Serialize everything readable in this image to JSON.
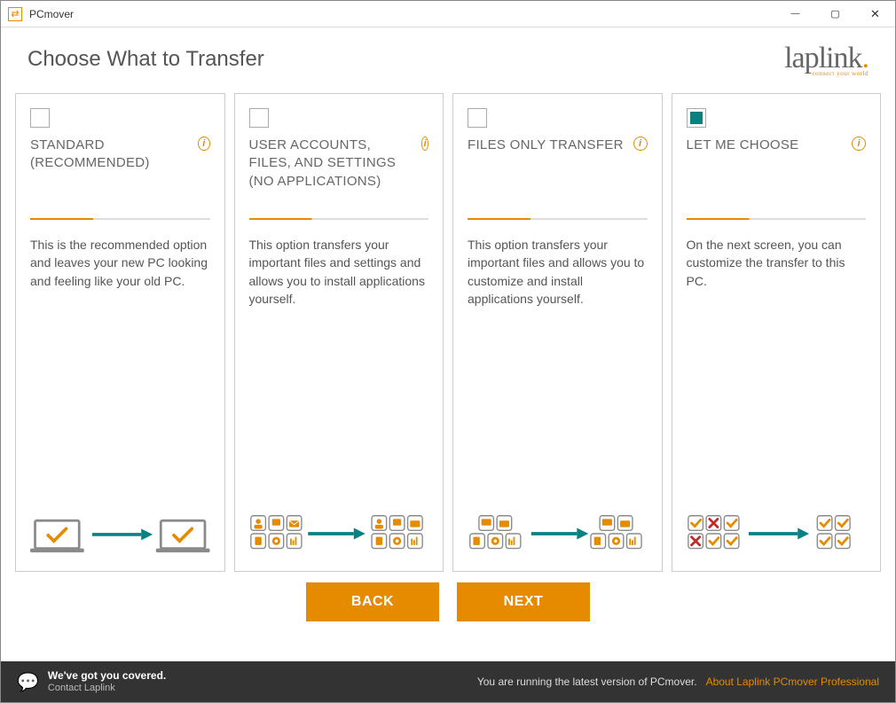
{
  "window": {
    "title": "PCmover"
  },
  "header": {
    "page_title": "Choose What to Transfer",
    "brand": "laplink",
    "brand_sub": "connect your world"
  },
  "cards": [
    {
      "title": "STANDARD (RECOMMENDED)",
      "desc": "This is the recommended option and leaves your new PC looking and feeling like your old PC.",
      "selected": false
    },
    {
      "title": "USER ACCOUNTS, FILES, AND SETTINGS (NO APPLICATIONS)",
      "desc": "This option transfers your important files and settings and allows you to install applications yourself.",
      "selected": false
    },
    {
      "title": "FILES ONLY TRANSFER",
      "desc": "This option transfers your important files and allows you to customize and install applications yourself.",
      "selected": false
    },
    {
      "title": "LET ME CHOOSE",
      "desc": "On the next screen, you can customize the transfer to this PC.",
      "selected": true
    }
  ],
  "nav": {
    "back": "BACK",
    "next": "NEXT"
  },
  "footer": {
    "support_line1": "We've got you covered.",
    "support_line2": "Contact Laplink",
    "status": "You are running the latest version of PCmover.",
    "about": "About Laplink PCmover Professional"
  }
}
